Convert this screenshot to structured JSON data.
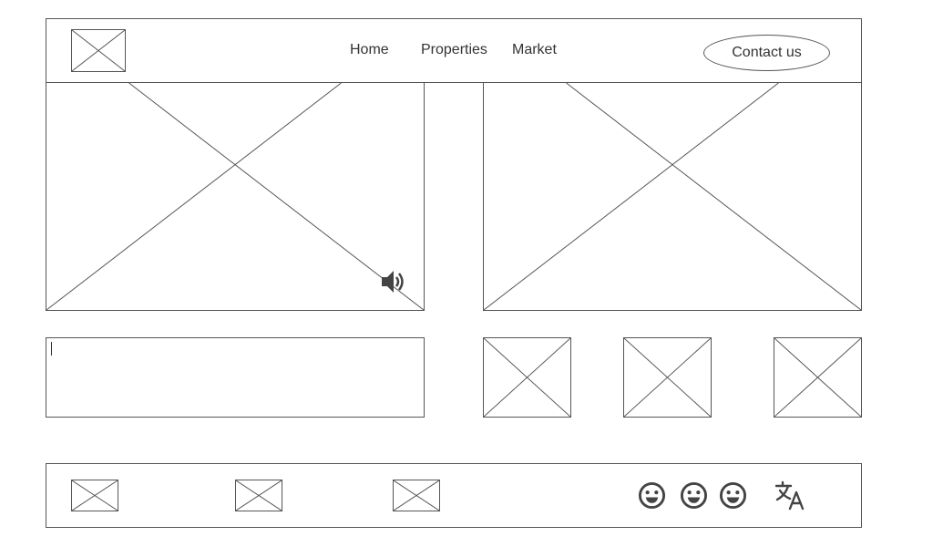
{
  "header": {
    "nav": [
      {
        "label": "Home"
      },
      {
        "label": "Properties"
      },
      {
        "label": "Market"
      }
    ],
    "contact_label": "Contact us"
  },
  "media": {
    "sound_icon": "speaker-icon"
  },
  "text_area": {
    "value": ""
  },
  "footer": {
    "emoji_icons": [
      "smiley-icon",
      "smiley-icon",
      "smiley-icon"
    ],
    "translate_icon": "translate-icon"
  },
  "colors": {
    "stroke": "#555555",
    "text": "#333333",
    "background": "#ffffff"
  }
}
